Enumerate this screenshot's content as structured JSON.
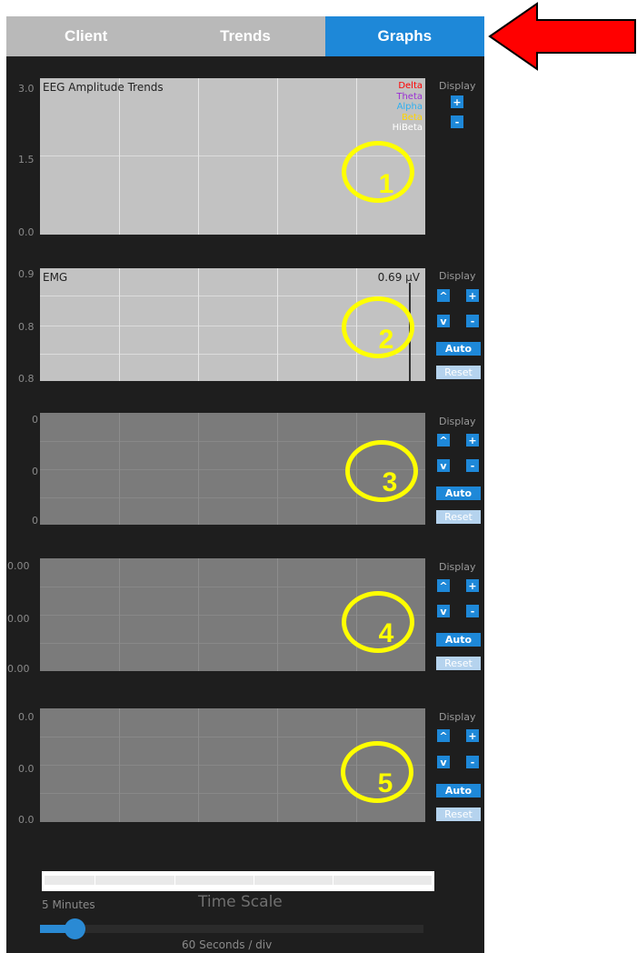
{
  "tabs": [
    {
      "label": "Client",
      "active": false
    },
    {
      "label": "Trends",
      "active": false
    },
    {
      "label": "Graphs",
      "active": true
    }
  ],
  "colors": {
    "accent": "#1e88d8",
    "annotation_yellow": "#ffff00",
    "annotation_arrow": "#ff0000",
    "legend_delta": "#ff0000",
    "legend_theta": "#9b2fd4",
    "legend_alpha": "#2fb0f0",
    "legend_beta": "#ffd400",
    "legend_hibeta": "#ffffff"
  },
  "annotations": {
    "arrow_icon": "red-left-arrow",
    "circle_numbers": [
      "1",
      "2",
      "3",
      "4",
      "5"
    ]
  },
  "graphs": [
    {
      "title": "EEG Amplitude Trends",
      "y_labels": [
        "3.0",
        "1.5",
        "0.0"
      ],
      "legend": [
        {
          "label": "Delta",
          "color": "#ff0000"
        },
        {
          "label": "Theta",
          "color": "#9b2fd4"
        },
        {
          "label": "Alpha",
          "color": "#2fb0f0"
        },
        {
          "label": "Beta",
          "color": "#ffd400"
        },
        {
          "label": "HiBeta",
          "color": "#ffffff"
        }
      ],
      "controls": {
        "display_label": "Display",
        "plus": "+",
        "minus": "-"
      }
    },
    {
      "title": "EMG",
      "reading": "0.69 µV",
      "y_labels": [
        "0.9",
        "0.8",
        "0.8"
      ],
      "controls": {
        "display_label": "Display",
        "up": "^",
        "down": "v",
        "plus": "+",
        "minus": "-",
        "auto": "Auto",
        "reset": "Reset"
      }
    },
    {
      "y_labels": [
        "0",
        "0",
        "0"
      ],
      "controls": {
        "display_label": "Display",
        "up": "^",
        "down": "v",
        "plus": "+",
        "minus": "-",
        "auto": "Auto",
        "reset": "Reset"
      }
    },
    {
      "y_labels": [
        "0.00",
        "0.00",
        "0.00"
      ],
      "controls": {
        "display_label": "Display",
        "up": "^",
        "down": "v",
        "plus": "+",
        "minus": "-",
        "auto": "Auto",
        "reset": "Reset"
      }
    },
    {
      "y_labels": [
        "0.0",
        "0.0",
        "0.0"
      ],
      "controls": {
        "display_label": "Display",
        "up": "^",
        "down": "v",
        "plus": "+",
        "minus": "-",
        "auto": "Auto",
        "reset": "Reset"
      }
    }
  ],
  "timescale": {
    "min_label": "5 Minutes",
    "title": "Time Scale",
    "value_label": "60 Seconds / div",
    "slider_value": 0.09
  }
}
